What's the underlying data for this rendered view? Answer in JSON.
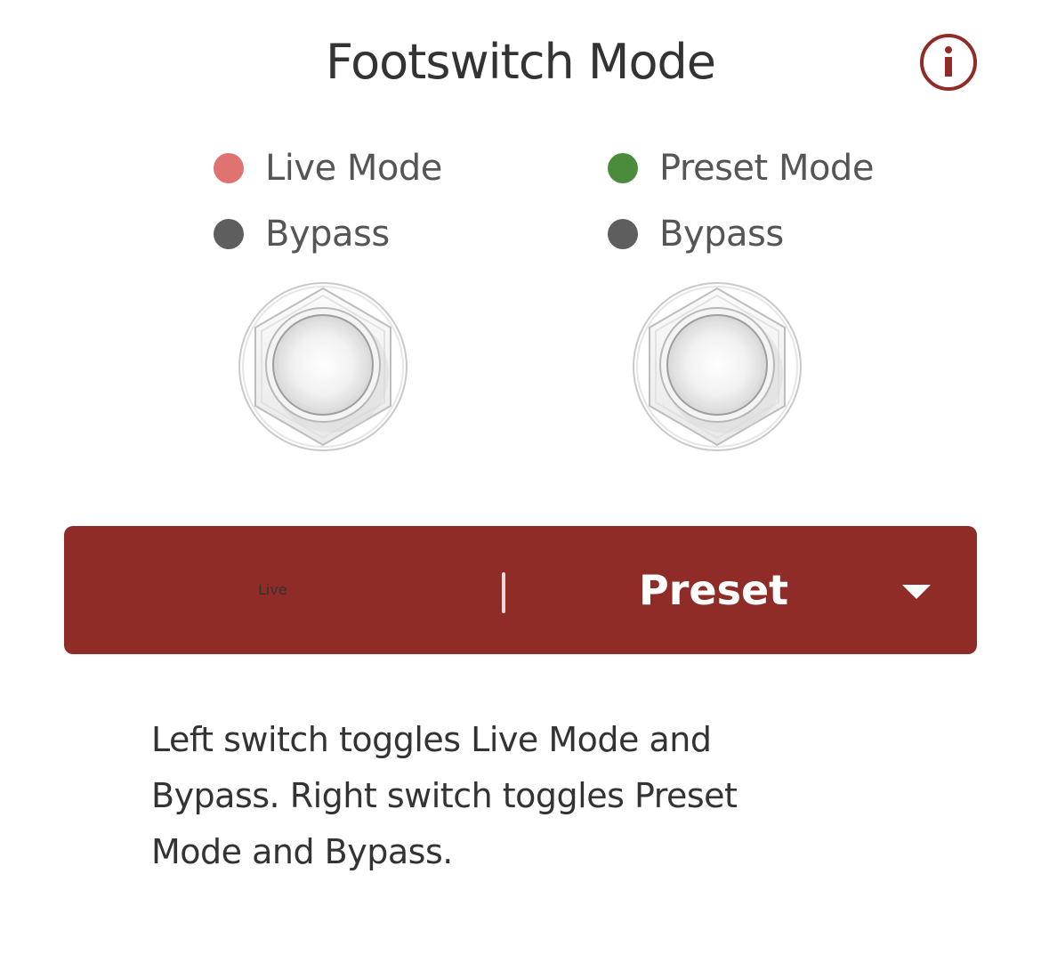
{
  "title": "Footswitch Mode",
  "info_icon": "info-circle-icon",
  "legends": {
    "left": [
      {
        "label": "Live Mode",
        "color": "#e07370"
      },
      {
        "label": "Bypass",
        "color": "#5e5e5e"
      }
    ],
    "right": [
      {
        "label": "Preset Mode",
        "color": "#4a8c3c"
      },
      {
        "label": "Bypass",
        "color": "#5e5e5e"
      }
    ]
  },
  "footswitch_icon": "footswitch-icon",
  "mode_selector": {
    "left_label": "Live",
    "right_label": "Preset",
    "dropdown_icon": "caret-down-icon",
    "background_color": "#8f2c27"
  },
  "description": "Left switch toggles Live Mode and Bypass. Right switch toggles Preset Mode and Bypass."
}
